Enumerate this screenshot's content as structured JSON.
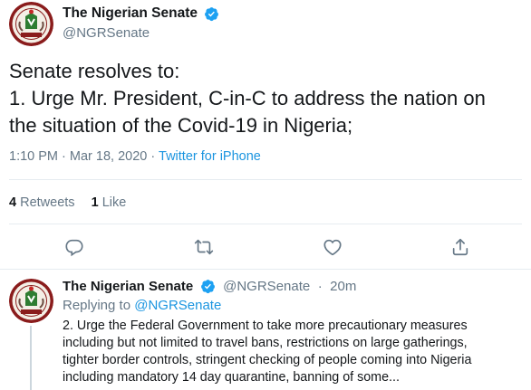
{
  "tweet": {
    "display_name": "The Nigerian Senate",
    "handle": "@NGRSenate",
    "text_lines": [
      "Senate resolves to:",
      "1. Urge Mr. President, C-in-C to address the nation on",
      "the situation of the Covid-19 in Nigeria;"
    ],
    "time": "1:10 PM",
    "date": "Mar 18, 2020",
    "separator": "·",
    "source": "Twitter for iPhone",
    "retweets_count": "4",
    "retweets_label": "Retweets",
    "likes_count": "1",
    "likes_label": "Like"
  },
  "actions": [
    "reply-icon",
    "retweet-icon",
    "like-icon",
    "share-icon"
  ],
  "reply": {
    "display_name": "The Nigerian Senate",
    "handle": "@NGRSenate",
    "separator": "·",
    "time_ago": "20m",
    "replying_prefix": "Replying to",
    "replying_to": "@NGRSenate",
    "text_lines": [
      "2. Urge the Federal Government to take more precautionary measures",
      "including but not limited to travel bans, restrictions on large gatherings,",
      "tighter border controls, stringent checking of people coming into Nigeria",
      "including mandatory 14 day quarantine, banning of some..."
    ]
  },
  "colors": {
    "text": "#14171a",
    "muted": "#657786",
    "link": "#1b95e0",
    "verified": "#1da1f2",
    "divider": "#e6ecf0"
  }
}
